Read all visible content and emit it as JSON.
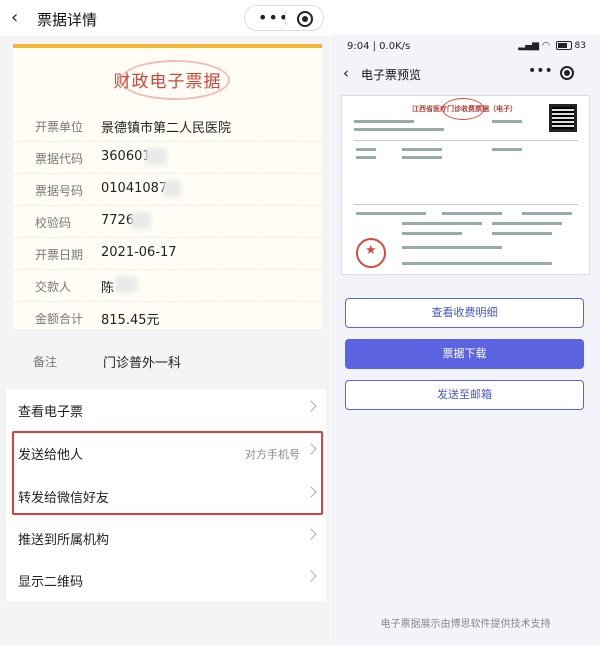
{
  "left": {
    "header": {
      "title": "票据详情"
    },
    "receipt": {
      "title": "财政电子票据",
      "rows": [
        {
          "label": "开票单位",
          "value": "景德镇市第二人民医院"
        },
        {
          "label": "票据代码",
          "value": "360601"
        },
        {
          "label": "票据号码",
          "value": "01041087"
        },
        {
          "label": "校验码",
          "value": "7726"
        },
        {
          "label": "开票日期",
          "value": "2021-06-17"
        },
        {
          "label": "交款人",
          "value": "陈"
        },
        {
          "label": "金额合计",
          "value": "815.45元"
        }
      ],
      "remark": {
        "label": "备注",
        "value": "门诊普外一科"
      }
    },
    "menu": [
      {
        "label": "查看电子票",
        "hint": ""
      },
      {
        "label": "发送给他人",
        "hint": "对方手机号"
      },
      {
        "label": "转发给微信好友",
        "hint": ""
      },
      {
        "label": "推送到所属机构",
        "hint": ""
      },
      {
        "label": "显示二维码",
        "hint": ""
      }
    ],
    "highlight_color": "#d9423c",
    "accent_color": "#f3b733"
  },
  "right": {
    "status": {
      "time": "9:04 | 0.0K/s",
      "battery": "83"
    },
    "header": {
      "title": "电子票预览"
    },
    "document": {
      "title": "江西省医疗门诊收费票据（电子）"
    },
    "buttons": {
      "detail": "查看收费明细",
      "download": "票据下载",
      "email": "发送至邮箱"
    },
    "footer": "电子票据展示由博思软件提供技术支持",
    "primary_color": "#5b63e0"
  }
}
